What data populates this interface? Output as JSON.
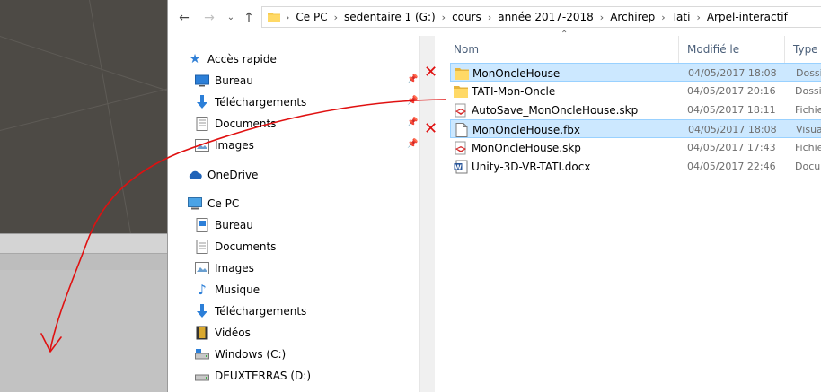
{
  "address": {
    "crumbs": [
      "Ce PC",
      "sedentaire 1 (G:)",
      "cours",
      "année 2017-2018",
      "Archirep",
      "Tati",
      "Arpel-interactif"
    ]
  },
  "columns": {
    "name": "Nom",
    "modified": "Modifié le",
    "type": "Type"
  },
  "nav": {
    "quick_access": "Accès rapide",
    "quick_items": [
      "Bureau",
      "Téléchargements",
      "Documents",
      "Images"
    ],
    "onedrive": "OneDrive",
    "this_pc": "Ce PC",
    "pc_items": [
      "Bureau",
      "Documents",
      "Images",
      "Musique",
      "Téléchargements",
      "Vidéos",
      "Windows (C:)",
      "DEUXTERRAS (D:)"
    ]
  },
  "files": [
    {
      "name": "MonOncleHouse",
      "date": "04/05/2017 18:08",
      "type": "Dossi",
      "icon": "folder",
      "selected": true,
      "marked": true
    },
    {
      "name": "TATI-Mon-Oncle",
      "date": "04/05/2017 20:16",
      "type": "Dossi",
      "icon": "folder",
      "selected": false,
      "marked": false
    },
    {
      "name": "AutoSave_MonOncleHouse.skp",
      "date": "04/05/2017 18:11",
      "type": "Fichie",
      "icon": "sketchup",
      "selected": false,
      "marked": false
    },
    {
      "name": "MonOncleHouse.fbx",
      "date": "04/05/2017 18:08",
      "type": "Visua",
      "icon": "file",
      "selected": true,
      "marked": true
    },
    {
      "name": "MonOncleHouse.skp",
      "date": "04/05/2017 17:43",
      "type": "Fichie",
      "icon": "sketchup",
      "selected": false,
      "marked": false
    },
    {
      "name": "Unity-3D-VR-TATI.docx",
      "date": "04/05/2017 22:46",
      "type": "Docu",
      "icon": "word",
      "selected": false,
      "marked": false
    }
  ],
  "colors": {
    "selection": "#cce8ff",
    "selection_border": "#99d1ff",
    "annotation": "#e01010",
    "folder": "#f5c94c"
  }
}
